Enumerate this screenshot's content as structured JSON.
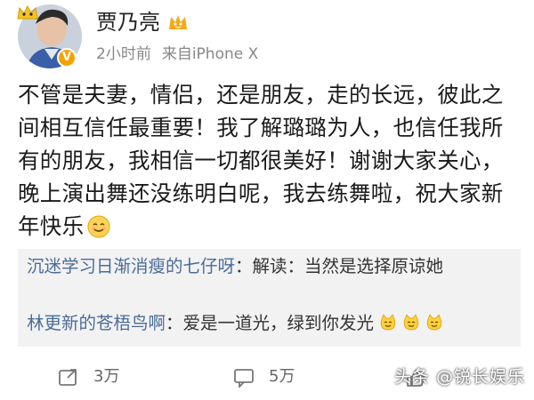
{
  "post": {
    "author": "贾乃亮",
    "time": "2小时前",
    "source": "来自iPhone X",
    "text": "不管是夫妻，情侣，还是朋友，走的长远，彼此之间相互信任最重要！我了解璐璐为人，也信任我所有的朋友，我相信一切都很美好！谢谢大家关心，晚上演出舞还没练明白呢，我去练舞啦，祝大家新年快乐",
    "text_emoji": "smile-emoji"
  },
  "comments": [
    {
      "handle": "沉迷学习日渐消瘦的七仔呀",
      "separator": "：",
      "text": "解读：当然是选择原谅她",
      "emojis": []
    },
    {
      "handle": "林更新的苍梧鸟啊",
      "separator": "：",
      "text": "爱是一道光，绿到你发光",
      "emojis": [
        "cat-emoji",
        "cat-emoji",
        "cat-emoji"
      ]
    }
  ],
  "actions": {
    "repost_count": "3万",
    "comment_count": "5万",
    "like_count": ""
  },
  "watermark": "头条 @锐长娱乐",
  "colors": {
    "handle": "#4a6c99",
    "verified_badge": "#f5a300",
    "comment_bg": "#f2f2f2"
  }
}
